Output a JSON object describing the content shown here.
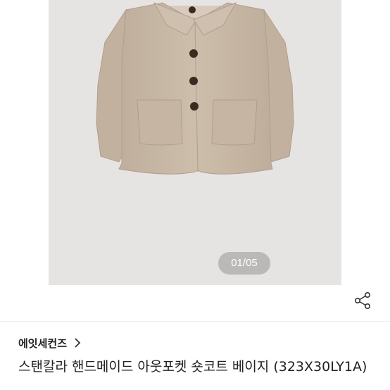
{
  "gallery": {
    "page_indicator": "01/05",
    "image_subject": "beige wool short coat with collar, four dark buttons and two patch pockets"
  },
  "actions": {
    "share_icon": "share-icon"
  },
  "seller": {
    "name": "에잇세컨즈",
    "chevron_icon": "chevron-right-icon"
  },
  "product": {
    "title": "스탠칼라 핸드메이드 아웃포켓 숏코트 베이지 (323X30LY1A)"
  },
  "colors": {
    "coat": "#c9b8a6",
    "gallery_bg": "#e6e4e2",
    "buttons": "#3a2a22"
  }
}
